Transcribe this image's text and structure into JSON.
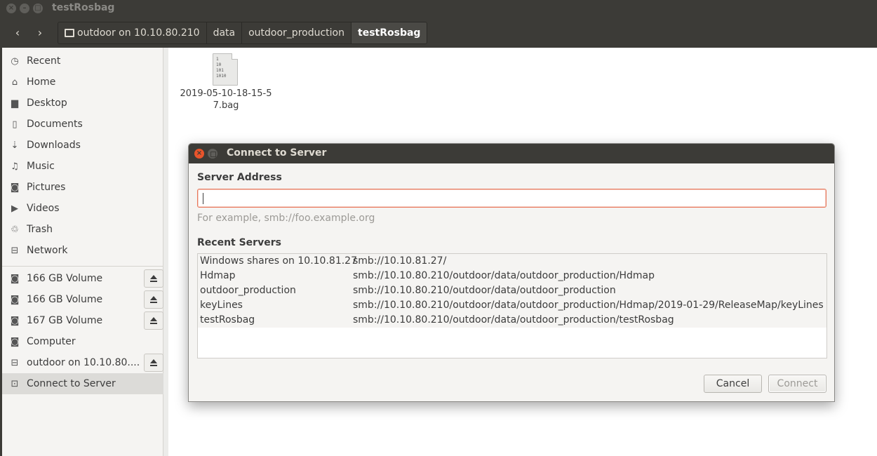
{
  "window": {
    "title": "testRosbag",
    "controls": [
      "×",
      "–",
      "□"
    ]
  },
  "breadcrumbs": [
    {
      "label": "outdoor on 10.10.80.210",
      "icon": "network-drive-icon"
    },
    {
      "label": "data"
    },
    {
      "label": "outdoor_production"
    },
    {
      "label": "testRosbag",
      "active": true
    }
  ],
  "nav": {
    "back": "‹",
    "forward": "›"
  },
  "sidebar": {
    "places": [
      {
        "label": "Recent",
        "icon": "clock-icon",
        "glyph": "◷"
      },
      {
        "label": "Home",
        "icon": "home-icon",
        "glyph": "⌂"
      },
      {
        "label": "Desktop",
        "icon": "desktop-folder-icon",
        "glyph": "▆"
      },
      {
        "label": "Documents",
        "icon": "document-icon",
        "glyph": "▯"
      },
      {
        "label": "Downloads",
        "icon": "download-icon",
        "glyph": "⇣"
      },
      {
        "label": "Music",
        "icon": "music-icon",
        "glyph": "♫"
      },
      {
        "label": "Pictures",
        "icon": "camera-icon",
        "glyph": "◙"
      },
      {
        "label": "Videos",
        "icon": "video-icon",
        "glyph": "▶"
      },
      {
        "label": "Trash",
        "icon": "trash-icon",
        "glyph": "♲"
      },
      {
        "label": "Network",
        "icon": "network-icon",
        "glyph": "⊟"
      }
    ],
    "devices": [
      {
        "label": "166 GB Volume",
        "icon": "drive-icon",
        "glyph": "◙",
        "eject": true
      },
      {
        "label": "166 GB Volume",
        "icon": "drive-icon",
        "glyph": "◙",
        "eject": true
      },
      {
        "label": "167 GB Volume",
        "icon": "drive-icon",
        "glyph": "◙",
        "eject": true
      },
      {
        "label": "Computer",
        "icon": "computer-icon",
        "glyph": "◙",
        "eject": false
      },
      {
        "label": "outdoor on 10.10.80....",
        "icon": "network-drive-icon",
        "glyph": "⊟",
        "eject": true
      },
      {
        "label": "Connect to Server",
        "icon": "connect-server-icon",
        "glyph": "⊡",
        "eject": false,
        "selected": true
      }
    ]
  },
  "content": {
    "file": {
      "name": "2019-05-10-18-15-57.bag",
      "icon_text": [
        "1",
        "10",
        "101",
        "1010"
      ]
    }
  },
  "dialog": {
    "title": "Connect to Server",
    "server_address_label": "Server Address",
    "server_address_value": "",
    "hint": "For example, smb://foo.example.org",
    "recent_label": "Recent Servers",
    "recent_servers": [
      {
        "name": "Windows shares on 10.10.81.27",
        "url": "smb://10.10.81.27/"
      },
      {
        "name": "Hdmap",
        "url": "smb://10.10.80.210/outdoor/data/outdoor_production/Hdmap"
      },
      {
        "name": "outdoor_production",
        "url": "smb://10.10.80.210/outdoor/data/outdoor_production"
      },
      {
        "name": "keyLines",
        "url": "smb://10.10.80.210/outdoor/data/outdoor_production/Hdmap/2019-01-29/ReleaseMap/keyLines"
      },
      {
        "name": "testRosbag",
        "url": "smb://10.10.80.210/outdoor/data/outdoor_production/testRosbag"
      }
    ],
    "cancel_label": "Cancel",
    "connect_label": "Connect"
  },
  "colors": {
    "titlebar": "#3c3b37",
    "close_button": "#e9542b",
    "input_focus": "#e9765a"
  }
}
